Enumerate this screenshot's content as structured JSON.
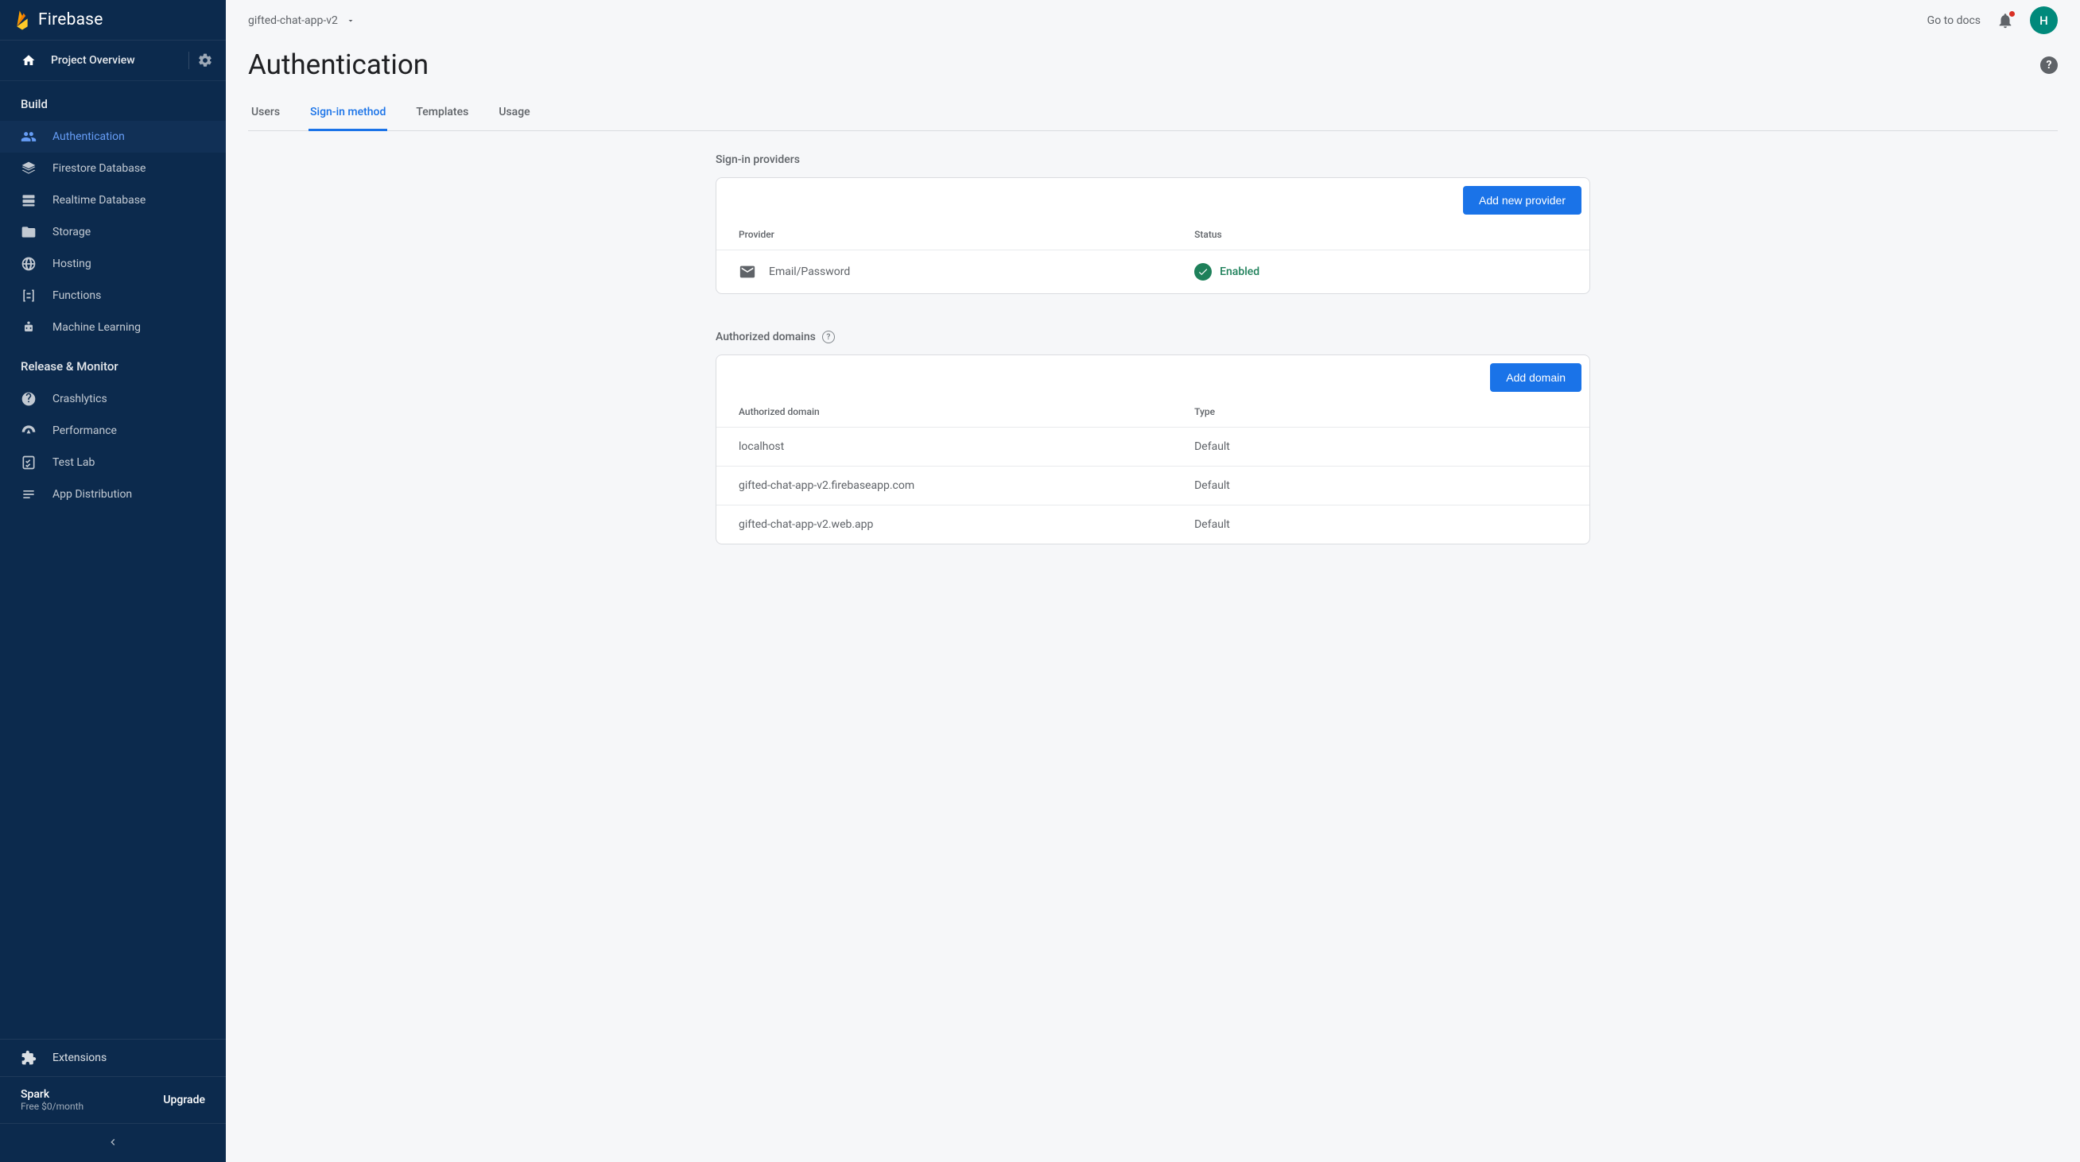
{
  "brand": "Firebase",
  "sidebar": {
    "project_overview": "Project Overview",
    "sections": [
      {
        "title": "Build",
        "items": [
          {
            "label": "Authentication",
            "icon": "people-icon",
            "active": true
          },
          {
            "label": "Firestore Database",
            "icon": "layers-icon",
            "active": false
          },
          {
            "label": "Realtime Database",
            "icon": "database-icon",
            "active": false
          },
          {
            "label": "Storage",
            "icon": "folder-icon",
            "active": false
          },
          {
            "label": "Hosting",
            "icon": "globe-icon",
            "active": false
          },
          {
            "label": "Functions",
            "icon": "functions-icon",
            "active": false
          },
          {
            "label": "Machine Learning",
            "icon": "robot-icon",
            "active": false
          }
        ]
      },
      {
        "title": "Release & Monitor",
        "items": [
          {
            "label": "Crashlytics",
            "icon": "crash-icon",
            "active": false
          },
          {
            "label": "Performance",
            "icon": "gauge-icon",
            "active": false
          },
          {
            "label": "Test Lab",
            "icon": "checklist-icon",
            "active": false
          },
          {
            "label": "App Distribution",
            "icon": "distribute-icon",
            "active": false
          }
        ]
      }
    ],
    "extensions_label": "Extensions",
    "plan": {
      "name": "Spark",
      "sub": "Free $0/month",
      "upgrade": "Upgrade"
    }
  },
  "topbar": {
    "project_name": "gifted-chat-app-v2",
    "docs_link": "Go to docs",
    "avatar_initial": "H"
  },
  "page": {
    "title": "Authentication",
    "tabs": [
      "Users",
      "Sign-in method",
      "Templates",
      "Usage"
    ],
    "active_tab_index": 1
  },
  "providers": {
    "section_label": "Sign-in providers",
    "add_button": "Add new provider",
    "columns": {
      "provider": "Provider",
      "status": "Status"
    },
    "rows": [
      {
        "name": "Email/Password",
        "status": "Enabled"
      }
    ]
  },
  "domains": {
    "section_label": "Authorized domains",
    "add_button": "Add domain",
    "columns": {
      "domain": "Authorized domain",
      "type": "Type"
    },
    "rows": [
      {
        "domain": "localhost",
        "type": "Default"
      },
      {
        "domain": "gifted-chat-app-v2.firebaseapp.com",
        "type": "Default"
      },
      {
        "domain": "gifted-chat-app-v2.web.app",
        "type": "Default"
      }
    ]
  }
}
